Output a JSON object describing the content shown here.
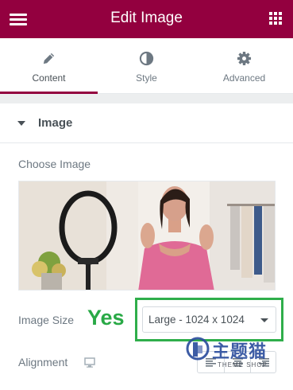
{
  "header": {
    "title": "Edit Image"
  },
  "tabs": [
    {
      "label": "Content",
      "icon": "pencil-icon",
      "active": true
    },
    {
      "label": "Style",
      "icon": "half-circle-icon",
      "active": false
    },
    {
      "label": "Advanced",
      "icon": "gear-icon",
      "active": false
    }
  ],
  "section": {
    "title": "Image",
    "expanded": true
  },
  "choose_image": {
    "label": "Choose Image"
  },
  "image_size": {
    "label": "Image Size",
    "value": "Large - 1024 x 1024"
  },
  "annotation": {
    "text": "Yes",
    "color": "#29a946"
  },
  "alignment": {
    "label": "Alignment",
    "device_icon": "monitor-icon"
  },
  "watermark": {
    "text": "主题猫",
    "sub": "THEME SHOP"
  },
  "colors": {
    "accent": "#93003f",
    "annotation_box": "#2fae4b"
  }
}
